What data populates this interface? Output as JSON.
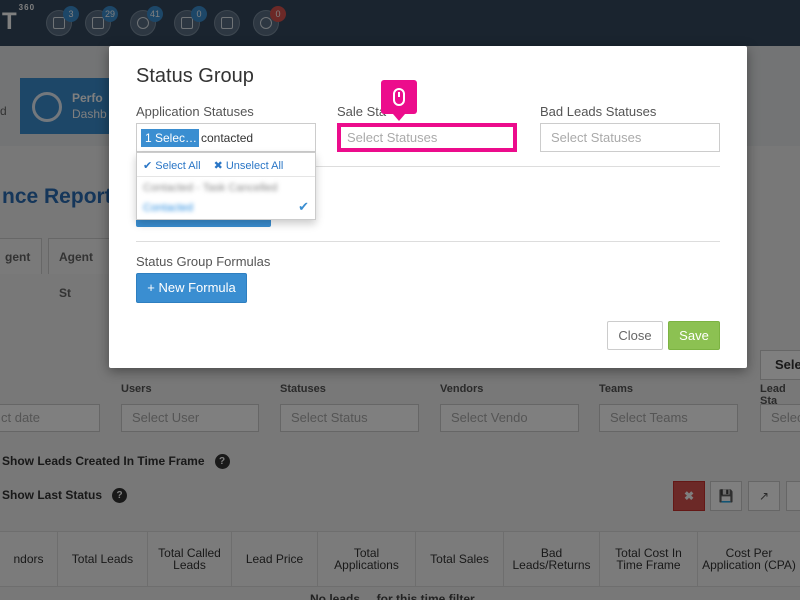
{
  "app": {
    "logo_text": "T",
    "logo_suffix": "360",
    "notifications": [
      {
        "icon": "file-icon",
        "count": "3"
      },
      {
        "icon": "document-icon",
        "count": "29"
      },
      {
        "icon": "chat-icon",
        "count": "41"
      },
      {
        "icon": "mail-icon",
        "count": "0"
      },
      {
        "icon": "inbox-icon",
        "count": ""
      },
      {
        "icon": "comment-icon",
        "count": "0"
      }
    ]
  },
  "background": {
    "nav_cut_label": "d",
    "perf_tile": {
      "line1": "Perfo",
      "line2": "Dashb"
    },
    "page_title": "nce Report",
    "tabs": [
      "gent",
      "Agent St"
    ],
    "select_button": "Sele",
    "filters": [
      {
        "label": "",
        "placeholder": "ct date"
      },
      {
        "label": "Users",
        "placeholder": "Select User"
      },
      {
        "label": "Statuses",
        "placeholder": "Select Status"
      },
      {
        "label": "Vendors",
        "placeholder": "Select Vendo"
      },
      {
        "label": "Teams",
        "placeholder": "Select Teams"
      },
      {
        "label": "Lead Sta",
        "placeholder": "Selec"
      }
    ],
    "option_show_leads": "Show Leads Created In Time Frame",
    "option_show_status": "Show Last Status",
    "help_symbol": "?",
    "action_buttons": [
      "✖",
      "💾",
      "↗",
      "‹"
    ],
    "table_headers": [
      "ndors",
      "Total Leads",
      "Total Called Leads",
      "Lead Price",
      "Total Applications",
      "Total Sales",
      "Bad Leads/Returns",
      "Total Cost In Time Frame",
      "Cost Per Application (CPA)"
    ],
    "table_bottom_text": "No leads ... for this time filter"
  },
  "modal": {
    "title": "Status Group",
    "application_statuses": {
      "label": "Application Statuses",
      "chip": "1 Selec…",
      "typed": "contacted",
      "dropdown": {
        "select_all": "✔ Select All",
        "unselect_all": "✖ Unselect All",
        "items": [
          "Contacted - Task Cancelled",
          "Contacted"
        ],
        "checked_mark": "✔"
      }
    },
    "sale_statuses": {
      "label": "Sale Sta",
      "placeholder": "Select Statuses"
    },
    "bad_leads_statuses": {
      "label": "Bad Leads Statuses",
      "placeholder": "Select Statuses"
    },
    "formulas": {
      "label": "Status Group Formulas",
      "new_button": "+ New Formula"
    },
    "close_label": "Close",
    "save_label": "Save"
  },
  "colors": {
    "accent": "#3a8ed1",
    "highlight": "#ec0c8c",
    "save": "#8cc152",
    "danger": "#d9534f"
  }
}
